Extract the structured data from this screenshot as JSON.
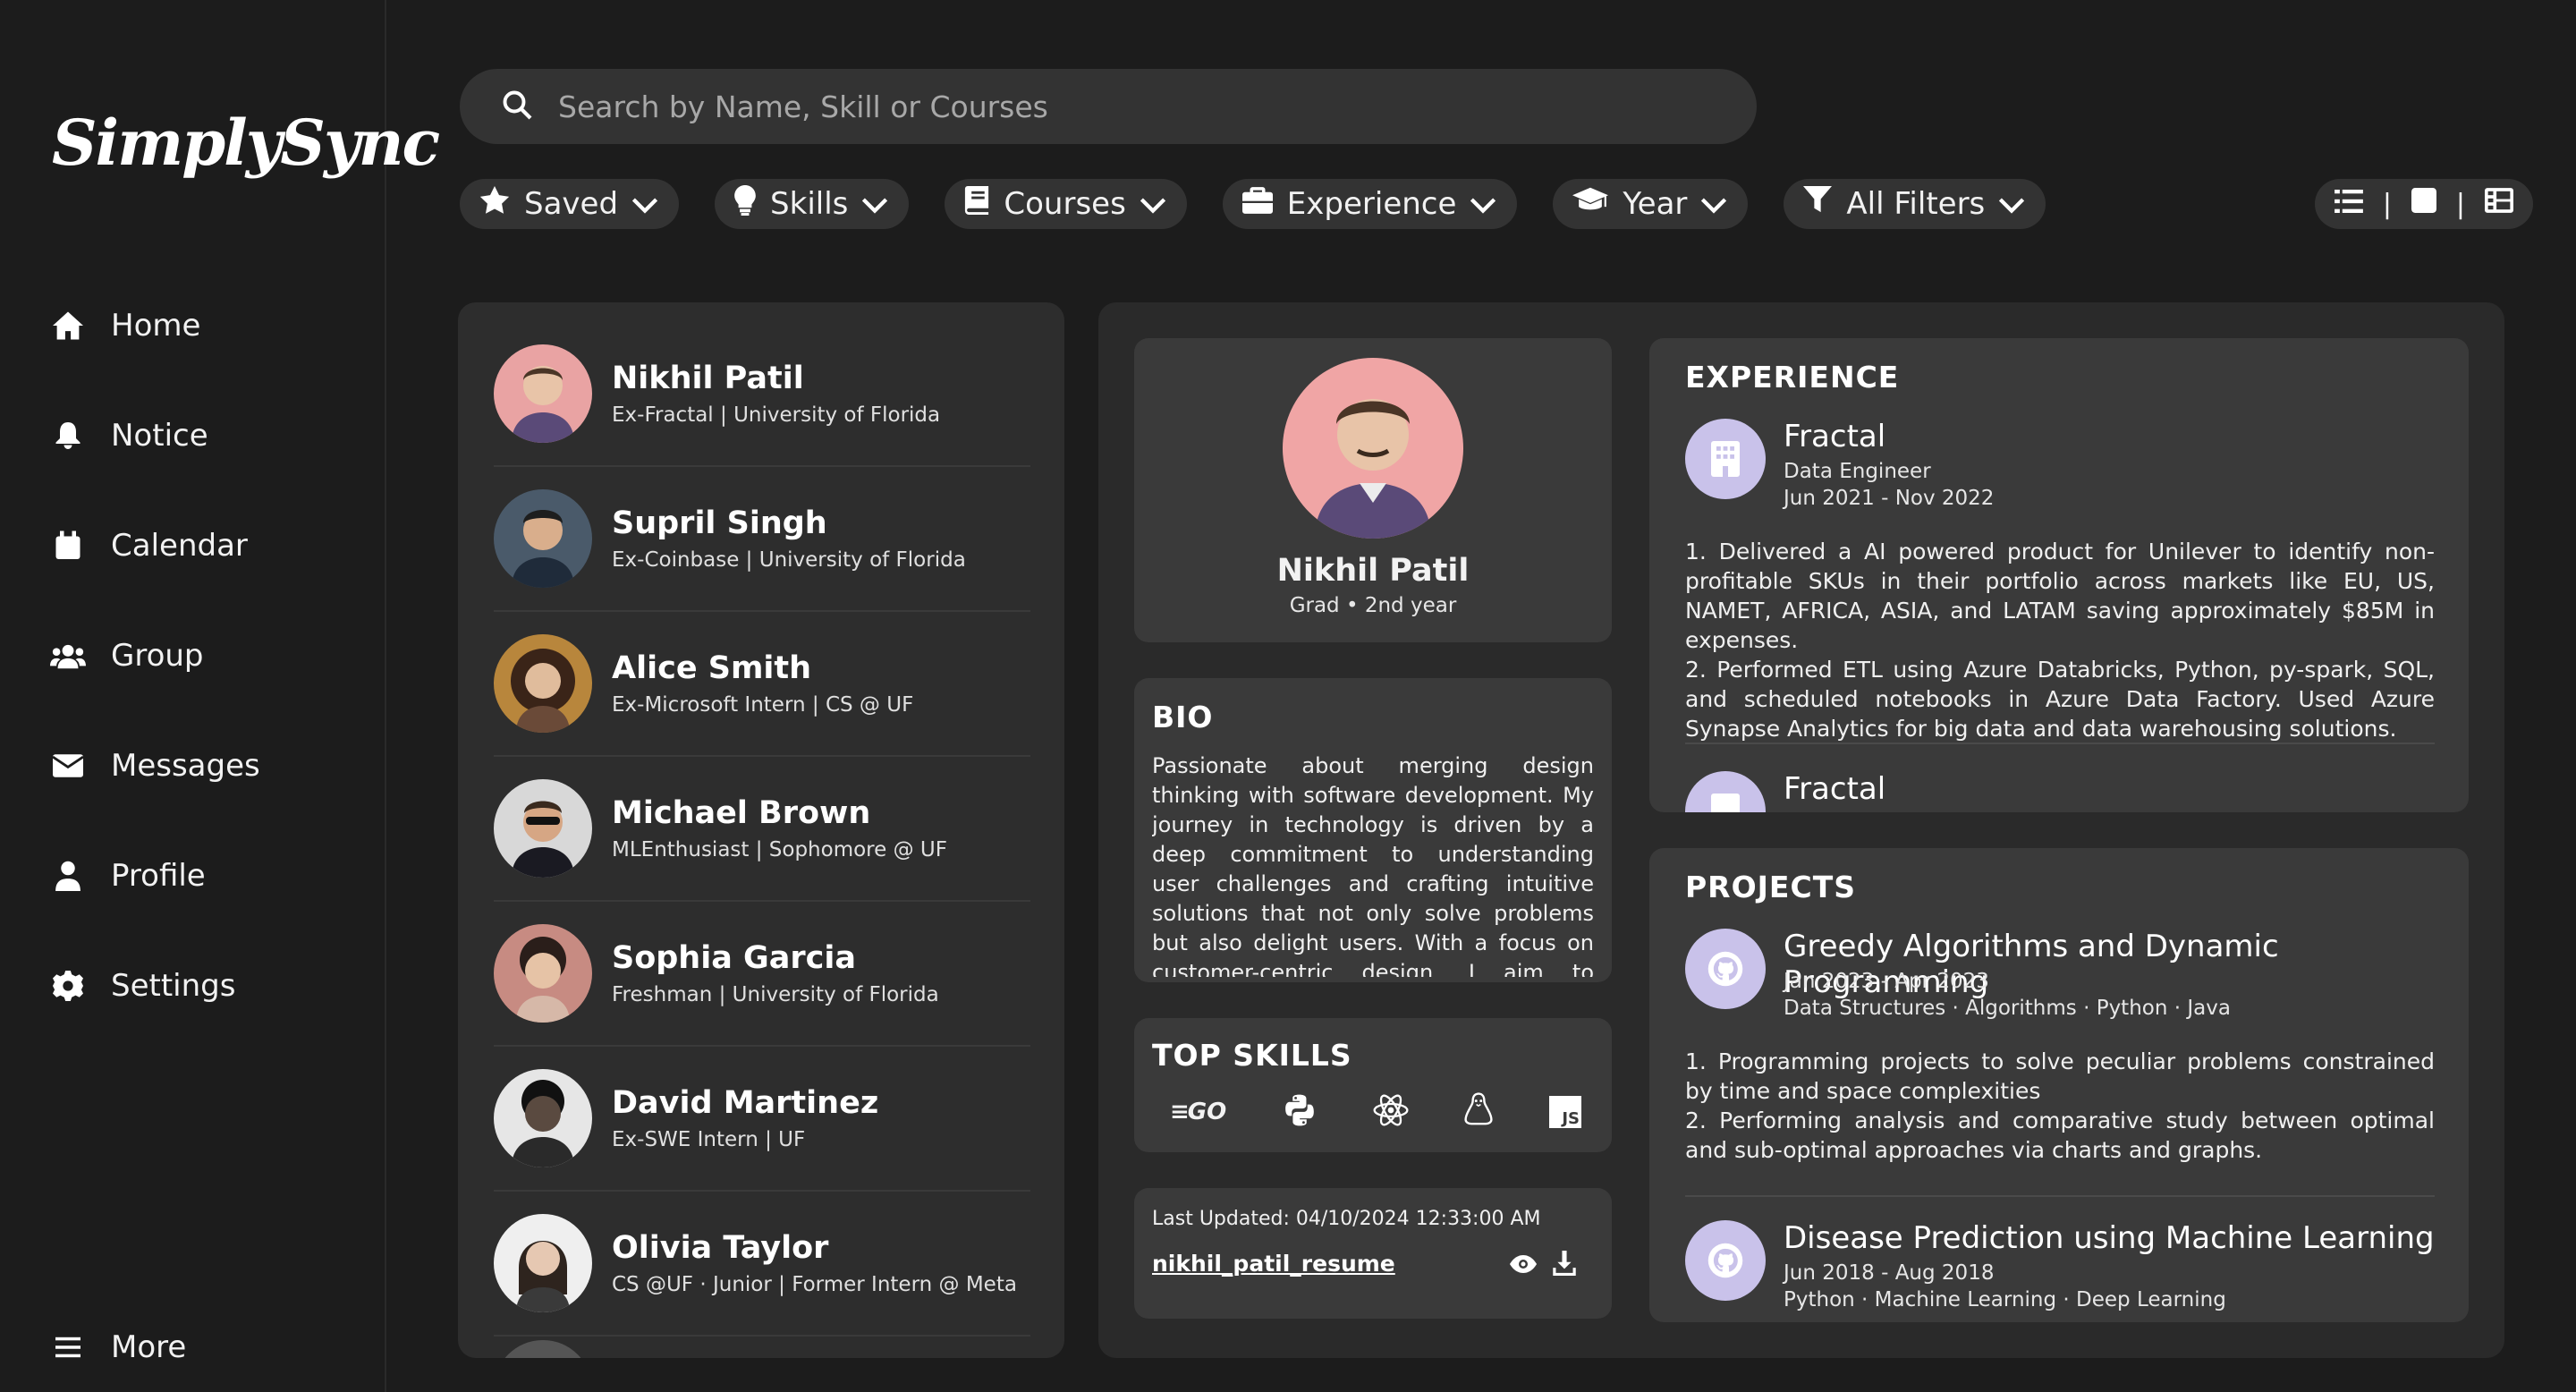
{
  "app": {
    "name": "SimplySync"
  },
  "sidebar": {
    "items": [
      {
        "label": "Home",
        "icon": "home-icon"
      },
      {
        "label": "Notice",
        "icon": "bell-icon"
      },
      {
        "label": "Calendar",
        "icon": "calendar-icon"
      },
      {
        "label": "Group",
        "icon": "group-icon"
      },
      {
        "label": "Messages",
        "icon": "envelope-icon"
      },
      {
        "label": "Profile",
        "icon": "user-icon"
      },
      {
        "label": "Settings",
        "icon": "gear-icon"
      }
    ],
    "more_label": "More"
  },
  "search": {
    "placeholder": "Search by Name, Skill or Courses"
  },
  "filters": [
    {
      "label": "Saved",
      "icon": "star-icon"
    },
    {
      "label": "Skills",
      "icon": "lightbulb-icon"
    },
    {
      "label": "Courses",
      "icon": "book-icon"
    },
    {
      "label": "Experience",
      "icon": "briefcase-icon"
    },
    {
      "label": "Year",
      "icon": "graduation-cap-icon"
    },
    {
      "label": "All Filters",
      "icon": "funnel-icon"
    }
  ],
  "people": [
    {
      "name": "Nikhil Patil",
      "subtitle": "Ex-Fractal | University of Florida",
      "avatar_bg": "#e9a3a3"
    },
    {
      "name": "Supril Singh",
      "subtitle": "Ex-Coinbase | University of Florida",
      "avatar_bg": "#4a5a6a"
    },
    {
      "name": "Alice Smith",
      "subtitle": "Ex-Microsoft Intern | CS @ UF",
      "avatar_bg": "#b8863c"
    },
    {
      "name": "Michael Brown",
      "subtitle": "MLEnthusiast | Sophomore @ UF",
      "avatar_bg": "#d8d8d8"
    },
    {
      "name": "Sophia Garcia",
      "subtitle": "Freshman | University of Florida",
      "avatar_bg": "#c78b82"
    },
    {
      "name": "David Martinez",
      "subtitle": "Ex-SWE Intern | UF",
      "avatar_bg": "#e6e6e6"
    },
    {
      "name": "Olivia Taylor",
      "subtitle": "CS @UF · Junior | Former Intern @ Meta",
      "avatar_bg": "#efefef"
    }
  ],
  "profile": {
    "name": "Nikhil Patil",
    "subtitle": "Grad • 2nd year",
    "avatar_bg": "#f0a5a5"
  },
  "bio": {
    "title": "BIO",
    "text": "Passionate about merging design thinking with software development. My journey in technology is driven by a deep commitment to understanding user challenges and crafting intuitive solutions that not only solve problems but also delight users. With a focus on customer-centric design, I aim to transform complex issues into simple, effec-"
  },
  "skills": {
    "title": "TOP SKILLS",
    "items": [
      "go-icon",
      "python-icon",
      "react-icon",
      "linux-icon",
      "javascript-icon"
    ],
    "go_text": "GO",
    "js_text": "JS"
  },
  "resume": {
    "last_updated": "Last Updated: 04/10/2024 12:33:00 AM",
    "filename": "nikhil_patil_resume"
  },
  "experience": {
    "title": "EXPERIENCE",
    "items": [
      {
        "company": "Fractal",
        "role": "Data Engineer",
        "dates": "Jun 2021 - Nov 2022",
        "description": "1. Delivered a AI powered product for Unilever to identify non-profitable SKUs in their portfolio across markets like EU, US, NAMET, AFRICA, ASIA, and LATAM saving approximately $85M in expenses.\n2. Performed ETL using Azure Databricks, Python, py-spark, SQL, and scheduled notebooks in Azure Data Factory. Used Azure Synapse Analytics for big data and data warehousing solutions."
      },
      {
        "company": "Fractal"
      }
    ]
  },
  "projects": {
    "title": "PROJECTS",
    "items": [
      {
        "title": "Greedy Algorithms and Dynamic Programming",
        "dates": "Jan 2023 - Apr 2023",
        "tags": "Data Structures · Algorithms · Python · Java",
        "description": "1. Programming projects to solve peculiar problems constrained by time and space complexities\n2. Performing analysis and comparative study between optimal and sub-optimal approaches via charts and graphs."
      },
      {
        "title": "Disease Prediction using Machine Learning",
        "dates": "Jun 2018 - Aug 2018",
        "tags": "Python · Machine Learning · Deep Learning"
      }
    ]
  },
  "colors": {
    "background": "#1c1c1c",
    "panel": "#2d2d2d",
    "card": "#3a3a3a",
    "accent_logo": "#c9c2ea"
  }
}
